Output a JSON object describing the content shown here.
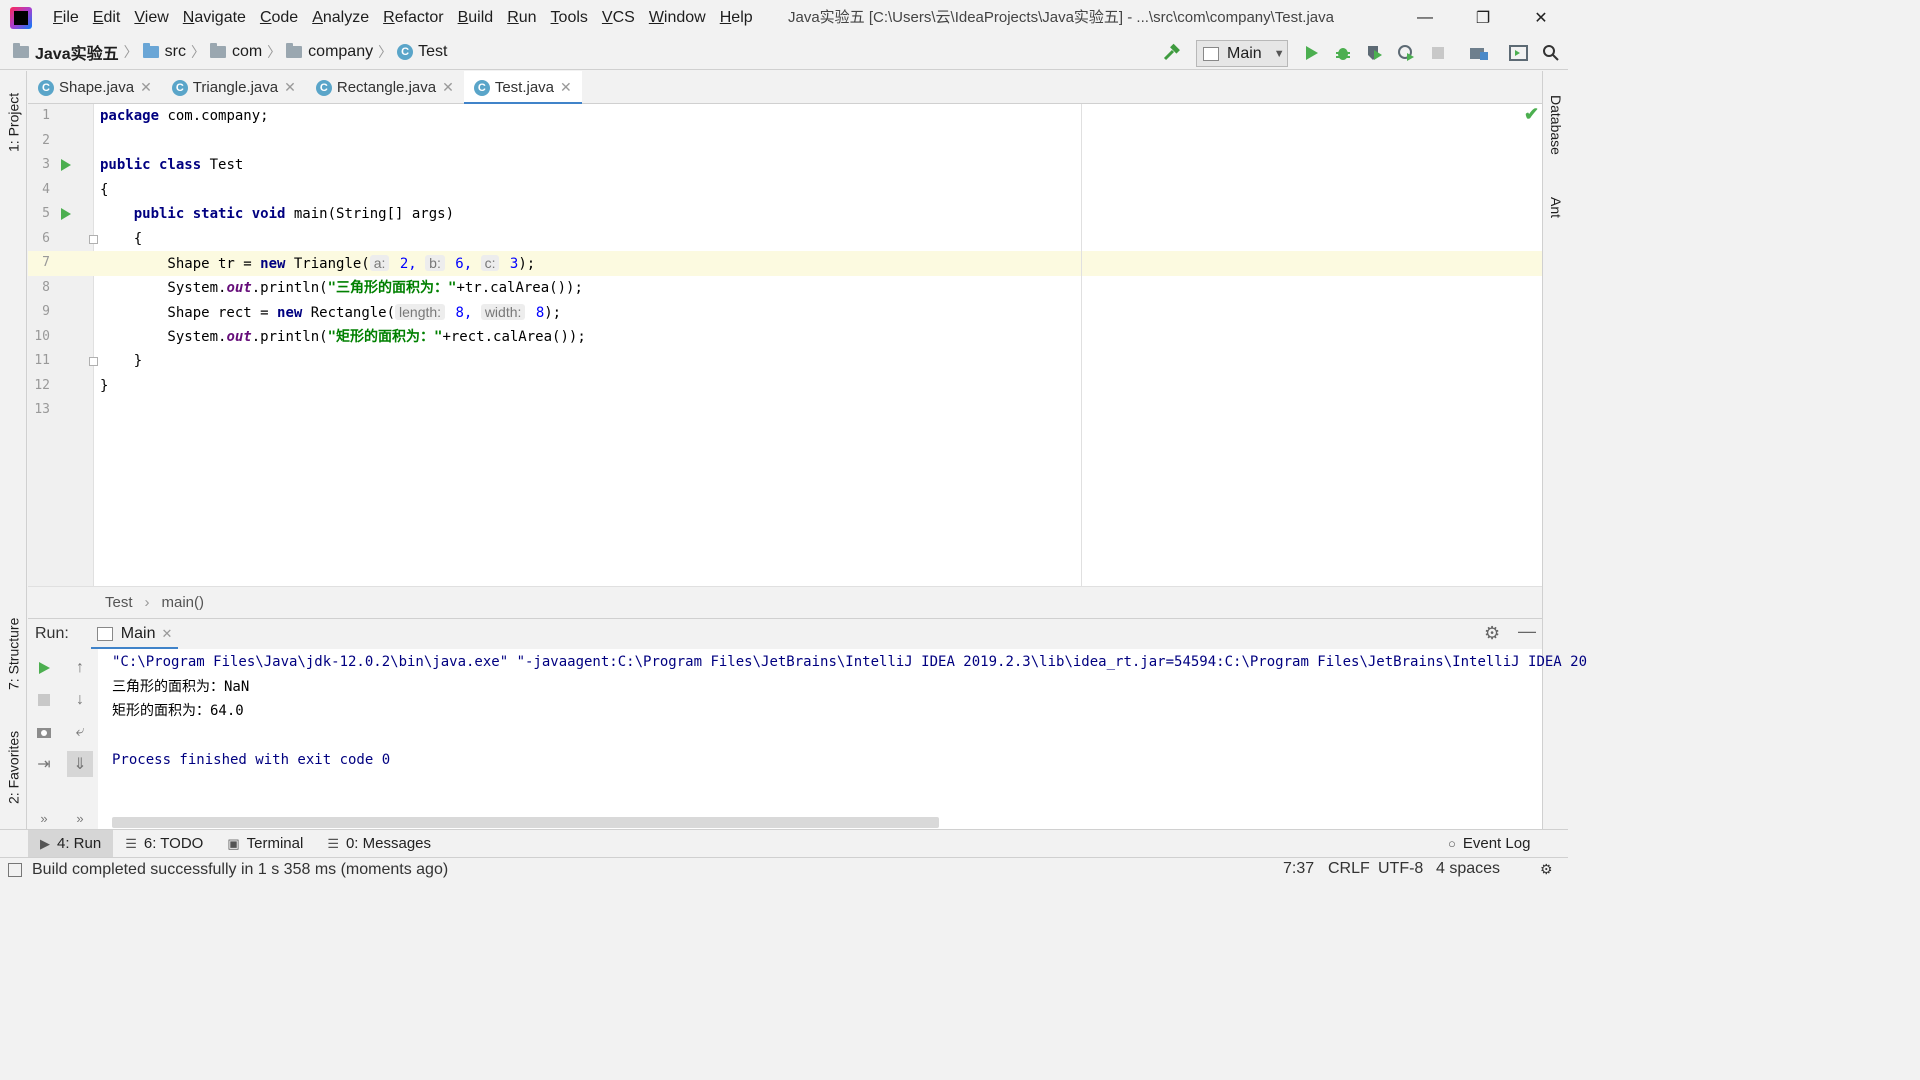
{
  "menu": {
    "items": [
      "File",
      "Edit",
      "View",
      "Navigate",
      "Code",
      "Analyze",
      "Refactor",
      "Build",
      "Run",
      "Tools",
      "VCS",
      "Window",
      "Help"
    ],
    "window_title": "Java实验五 [C:\\Users\\云\\IdeaProjects\\Java实验五] - ...\\src\\com\\company\\Test.java",
    "minimize": "—",
    "restore": "❐",
    "close": "✕"
  },
  "navbar": {
    "crumbs": [
      "Java实验五",
      "src",
      "com",
      "company",
      "Test"
    ],
    "run_config": "Main"
  },
  "left_strip": {
    "project": "1: Project",
    "structure": "7: Structure",
    "favorites": "2: Favorites"
  },
  "right_strip": {
    "database": "Database",
    "ant": "Ant"
  },
  "editor_tabs": [
    {
      "label": "Shape.java",
      "active": false
    },
    {
      "label": "Triangle.java",
      "active": false
    },
    {
      "label": "Rectangle.java",
      "active": false
    },
    {
      "label": "Test.java",
      "active": true
    }
  ],
  "editor": {
    "line_numbers": [
      "1",
      "2",
      "3",
      "4",
      "5",
      "6",
      "7",
      "8",
      "9",
      "10",
      "11",
      "12",
      "13"
    ],
    "lines": {
      "l1_kw": "package",
      "l1_rest": " com.company;",
      "l3_kw": "public class",
      "l3_rest": " Test",
      "l4": "{",
      "l5_kw": "    public static void",
      "l5_rest": " main(String[] args)",
      "l6": "    {",
      "l7_a": "        Shape tr = ",
      "l7_kw": "new",
      "l7_b": " Triangle(",
      "l7_hint_a": "a:",
      "l7_val_a": " 2,",
      "l7_hint_b": "b:",
      "l7_val_b": " 6,",
      "l7_hint_c": "c:",
      "l7_val_c": " 3",
      "l7_end": ");",
      "l8_a": "        System.",
      "l8_out": "out",
      "l8_b": ".println(",
      "l8_str": "\"三角形的面积为：\"",
      "l8_c": "+tr.calArea());",
      "l9_a": "        Shape rect = ",
      "l9_kw": "new",
      "l9_b": " Rectangle(",
      "l9_hint_len": "length:",
      "l9_val_len": " 8,",
      "l9_hint_wid": "width:",
      "l9_val_wid": " 8",
      "l9_end": ");",
      "l10_a": "        System.",
      "l10_out": "out",
      "l10_b": ".println(",
      "l10_str": "\"矩形的面积为：\"",
      "l10_c": "+rect.calArea());",
      "l11": "    }",
      "l12": "}"
    },
    "breadcrumb": [
      "Test",
      "main()"
    ]
  },
  "run_panel": {
    "label": "Run:",
    "tab": "Main",
    "console": [
      "\"C:\\Program Files\\Java\\jdk-12.0.2\\bin\\java.exe\" \"-javaagent:C:\\Program Files\\JetBrains\\IntelliJ IDEA 2019.2.3\\lib\\idea_rt.jar=54594:C:\\Program Files\\JetBrains\\IntelliJ IDEA 20",
      "三角形的面积为：NaN",
      "矩形的面积为：64.0",
      "",
      "Process finished with exit code 0"
    ]
  },
  "bottom_tabs": [
    {
      "label": "4: Run",
      "icon": "play-icon",
      "active": true
    },
    {
      "label": "6: TODO",
      "icon": "list-icon",
      "active": false
    },
    {
      "label": "Terminal",
      "icon": "terminal-icon",
      "active": false
    },
    {
      "label": "0: Messages",
      "icon": "messages-icon",
      "active": false
    }
  ],
  "event_log": "Event Log",
  "status": {
    "message": "Build completed successfully in 1 s 358 ms (moments ago)",
    "position": "7:37",
    "line_sep": "CRLF",
    "encoding": "UTF-8",
    "indent": "4 spaces"
  }
}
